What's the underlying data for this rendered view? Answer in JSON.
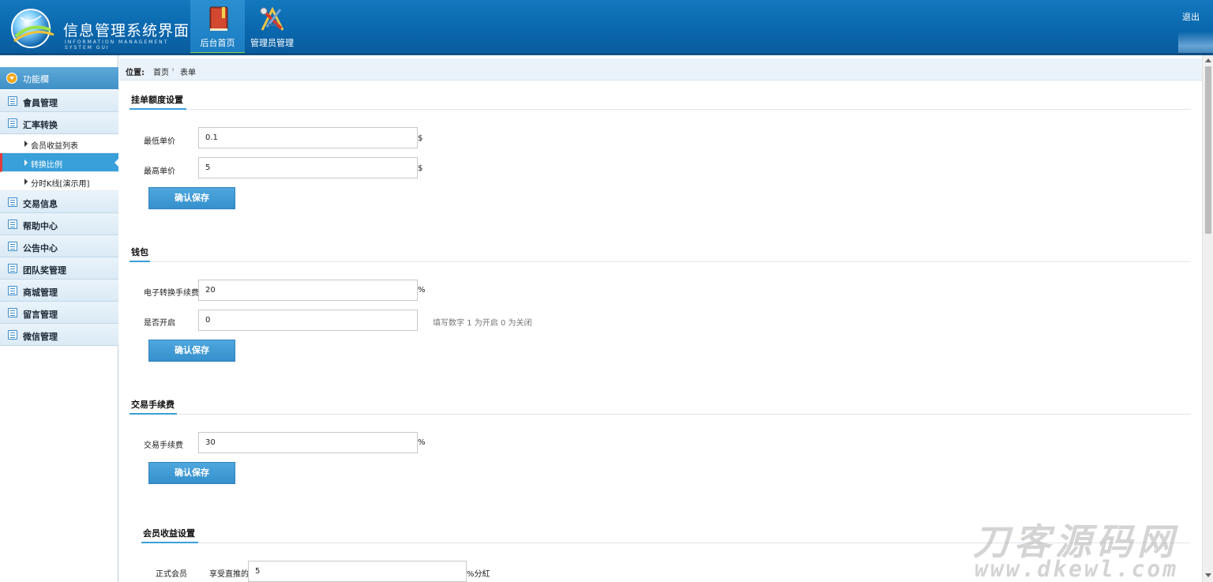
{
  "app": {
    "title": "信息管理系统界面",
    "subtitle": "INFORMATION MANAGEMENT SYSTEM GUI",
    "logout_label": "退出"
  },
  "topnav": [
    {
      "label": "后台首页",
      "icon": "book-icon",
      "active": true
    },
    {
      "label": "管理员管理",
      "icon": "tools-icon",
      "active": false
    }
  ],
  "sidebar": {
    "header_label": "功能欄",
    "items": [
      {
        "label": "會員管理",
        "icon": "list-icon"
      },
      {
        "label": "汇率转换",
        "icon": "chat-icon",
        "children": [
          {
            "label": "会员收益列表",
            "active": false
          },
          {
            "label": "转换比例",
            "active": true
          },
          {
            "label": "分时K线[演示用]",
            "active": false
          }
        ]
      },
      {
        "label": "交易信息",
        "icon": "list-icon"
      },
      {
        "label": "帮助中心",
        "icon": "edit-icon"
      },
      {
        "label": "公告中心",
        "icon": "edit-icon"
      },
      {
        "label": "团队奖管理",
        "icon": "calendar-icon"
      },
      {
        "label": "商城管理",
        "icon": "calendar-icon"
      },
      {
        "label": "留言管理",
        "icon": "edit-icon"
      },
      {
        "label": "微信管理",
        "icon": "chat-icon"
      }
    ]
  },
  "breadcrumb": {
    "lead": "位置:",
    "items": [
      "首页",
      "表单"
    ],
    "separator": "›"
  },
  "sections": {
    "order_limit": {
      "title": "挂单额度设置",
      "min_label": "最低单价",
      "min_value": "0.1",
      "min_unit": "$",
      "max_label": "最高单价",
      "max_value": "5",
      "max_unit": "$",
      "save_label": "确认保存"
    },
    "wallet": {
      "title": "钱包",
      "fee_label": "电子转换手续费",
      "fee_value": "20",
      "fee_unit": "%",
      "enable_label": "是否开启",
      "enable_value": "0",
      "enable_hint": "填写数字 1 为开启 0 为关闭",
      "save_label": "确认保存"
    },
    "trade_fee": {
      "title": "交易手续费",
      "fee_label": "交易手续费",
      "fee_value": "30",
      "fee_unit": "%",
      "save_label": "确认保存"
    },
    "member_income": {
      "title": "会员收益设置",
      "row_label": "正式会员",
      "row_sublabel": "享受直推的",
      "row_value": "5",
      "row_unit": "%分紅"
    }
  },
  "watermark": {
    "top": "刀客源码网",
    "bottom": "www.dkewl.com"
  },
  "colors": {
    "header_bg": "#0a67ad",
    "accent": "#39a0da",
    "active_marker": "#e33a3a",
    "nav_active_bar": "#8bd44a"
  }
}
